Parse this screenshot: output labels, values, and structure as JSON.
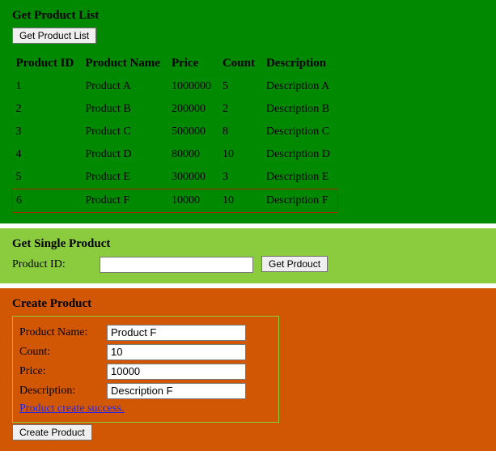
{
  "list_panel": {
    "title": "Get Product List",
    "button_label": "Get Product List",
    "columns": [
      "Product ID",
      "Product Name",
      "Price",
      "Count",
      "Description"
    ],
    "rows": [
      {
        "id": "1",
        "name": "Product A",
        "price": "1000000",
        "count": "5",
        "desc": "Description A",
        "highlight": false
      },
      {
        "id": "2",
        "name": "Product B",
        "price": "200000",
        "count": "2",
        "desc": "Description B",
        "highlight": false
      },
      {
        "id": "3",
        "name": "Product C",
        "price": "500000",
        "count": "8",
        "desc": "Description C",
        "highlight": false
      },
      {
        "id": "4",
        "name": "Product D",
        "price": "80000",
        "count": "10",
        "desc": "Description D",
        "highlight": false
      },
      {
        "id": "5",
        "name": "Product E",
        "price": "300000",
        "count": "3",
        "desc": "Description E",
        "highlight": false
      },
      {
        "id": "6",
        "name": "Product F",
        "price": "10000",
        "count": "10",
        "desc": "Description F",
        "highlight": true
      }
    ]
  },
  "single_panel": {
    "title": "Get Single Product",
    "label": "Product ID:",
    "value": "",
    "button_label": "Get Prdouct"
  },
  "create_panel": {
    "title": "Create Product",
    "fields": {
      "name_label": "Product Name:",
      "name_value": "Product F",
      "count_label": "Count:",
      "count_value": "10",
      "price_label": "Price:",
      "price_value": "10000",
      "desc_label": "Description:",
      "desc_value": "Description F"
    },
    "success_msg": "Product create success.",
    "button_label": "Create Product"
  }
}
